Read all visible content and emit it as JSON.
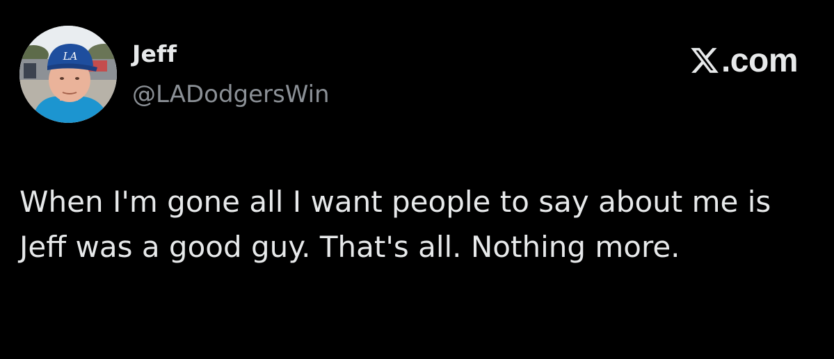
{
  "author": {
    "display_name": "Jeff",
    "handle": "@LADodgersWin",
    "avatar_icon": "profile-photo",
    "cap_logo": "LA"
  },
  "brand": {
    "text": ".com",
    "icon": "x-logo-icon"
  },
  "tweet": {
    "text": "When I'm gone all I want people to say about me is Jeff was a good guy. That's all. Nothing more."
  },
  "colors": {
    "background": "#000000",
    "primary_text": "#e7e9ea",
    "secondary_text": "#8b9096",
    "dodgers_blue": "#1e4e9e"
  }
}
